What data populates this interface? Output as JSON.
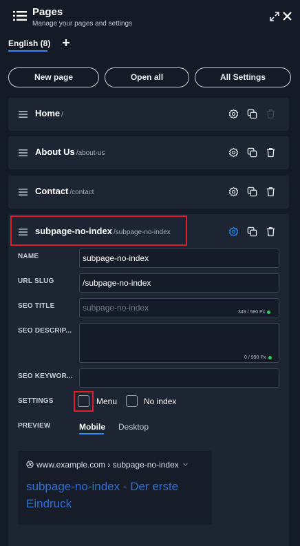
{
  "header": {
    "title": "Pages",
    "subtitle": "Manage your pages and settings"
  },
  "language_tab": {
    "label": "English (8)"
  },
  "toolbar": {
    "new_page": "New page",
    "open_all": "Open all",
    "all_settings": "All Settings"
  },
  "pages": [
    {
      "name": "Home",
      "slug": "/"
    },
    {
      "name": "About Us",
      "slug": "/about-us"
    },
    {
      "name": "Contact",
      "slug": "/contact"
    },
    {
      "name": "subpage-no-index",
      "slug": "/subpage-no-index"
    }
  ],
  "form": {
    "name_label": "NAME",
    "name_value": "subpage-no-index",
    "slug_label": "URL SLUG",
    "slug_value": "/subpage-no-index",
    "seo_title_label": "SEO TITLE",
    "seo_title_placeholder": "subpage-no-index",
    "seo_title_counter": "349 / 580 Px",
    "seo_desc_label": "SEO DESCRIP...",
    "seo_desc_counter": "0 / 990 Px",
    "seo_keywords_label": "SEO KEYWOR...",
    "settings_label": "SETTINGS",
    "menu_label": "Menu",
    "noindex_label": "No index",
    "preview_label": "PREVIEW",
    "tab_mobile": "Mobile",
    "tab_desktop": "Desktop"
  },
  "preview": {
    "url": "www.example.com › subpage-no-index",
    "title": "subpage-no-index - Der erste Eindruck"
  },
  "colors": {
    "background": "#141b26",
    "card": "#1d2533",
    "accent": "#2a8cff",
    "highlight": "#e21d25",
    "link": "#2f6fd6",
    "ok_dot": "#2fd15b"
  }
}
